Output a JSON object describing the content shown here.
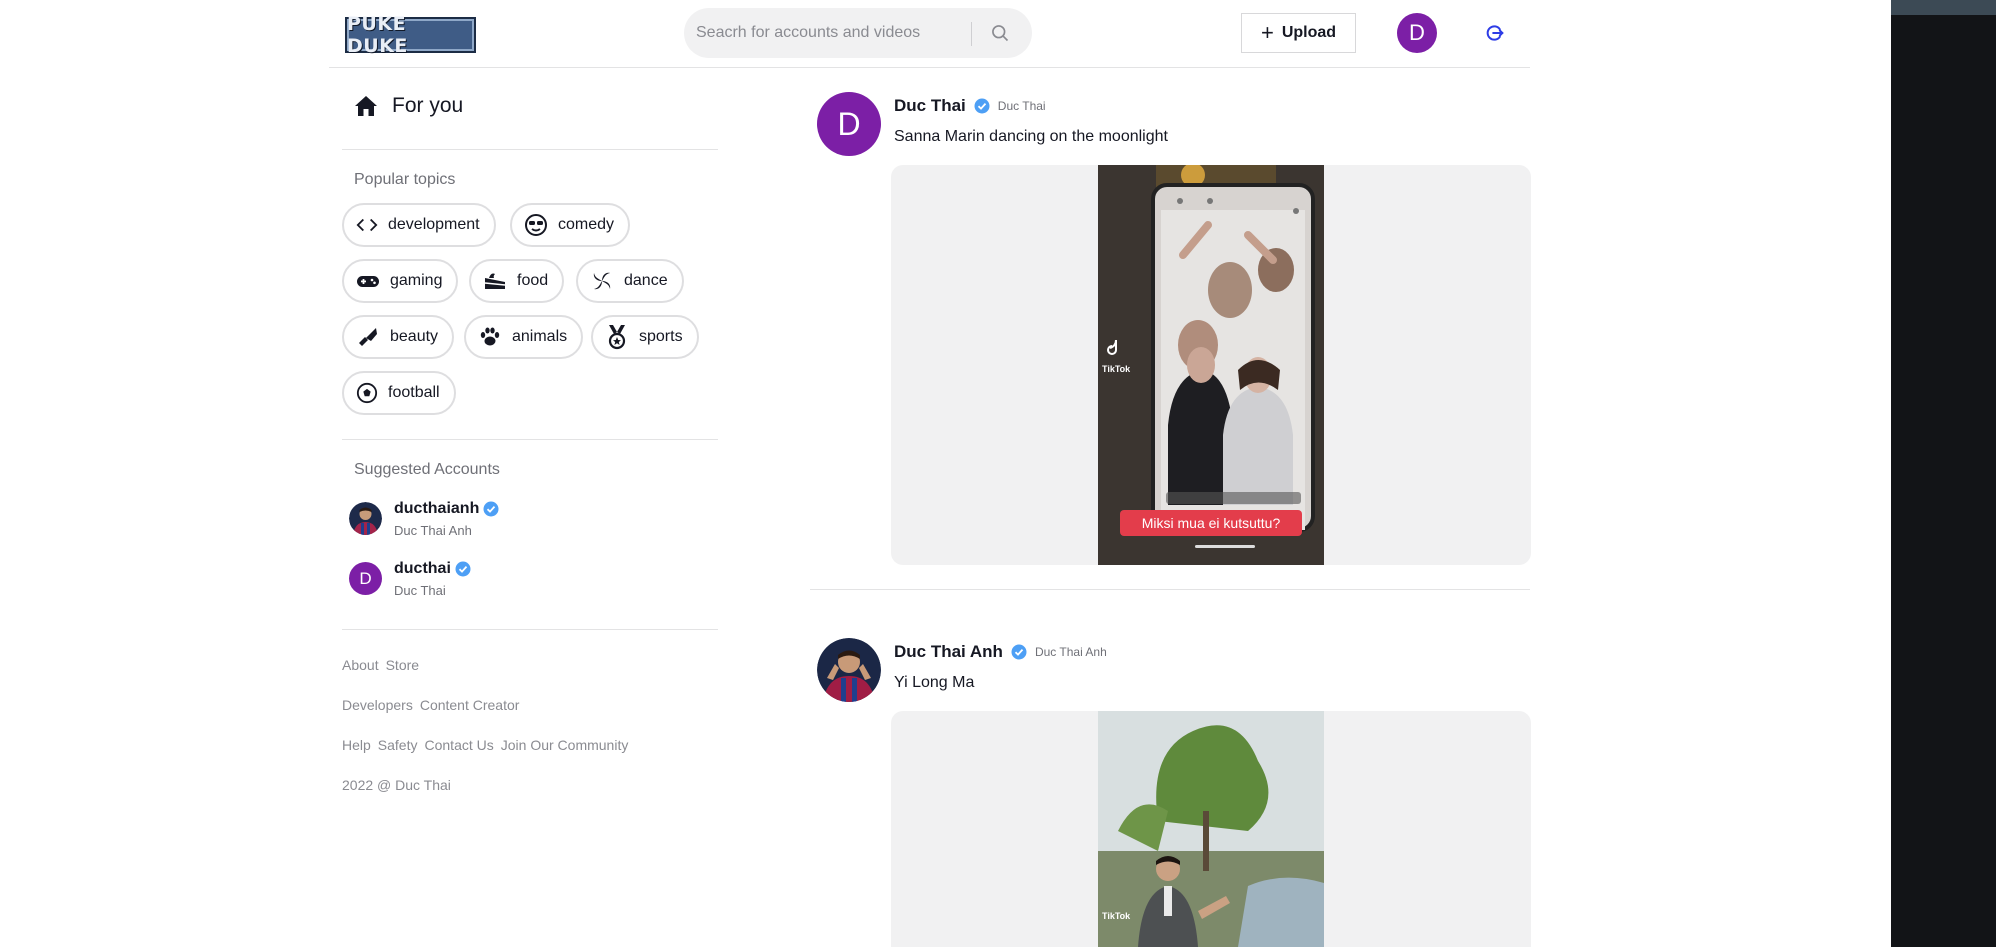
{
  "header": {
    "logo_text": "PUKE DUKE",
    "search_placeholder": "Seacrh for accounts and videos",
    "upload_label": "Upload",
    "avatar_letter": "D"
  },
  "sidebar": {
    "for_you": "For you",
    "popular_topics_title": "Popular topics",
    "topics": [
      {
        "label": "development",
        "icon": "code-icon"
      },
      {
        "label": "comedy",
        "icon": "sunglasses-face-icon"
      },
      {
        "label": "gaming",
        "icon": "gamepad-icon"
      },
      {
        "label": "food",
        "icon": "cake-icon"
      },
      {
        "label": "dance",
        "icon": "dance-swirl-icon"
      },
      {
        "label": "beauty",
        "icon": "lipstick-icon"
      },
      {
        "label": "animals",
        "icon": "paw-icon"
      },
      {
        "label": "sports",
        "icon": "medal-icon"
      },
      {
        "label": "football",
        "icon": "soccer-ball-icon"
      }
    ],
    "suggested_title": "Suggested Accounts",
    "accounts": [
      {
        "username": "ducthaianh",
        "name": "Duc Thai Anh",
        "verified": true
      },
      {
        "username": "ducthai",
        "name": "Duc Thai",
        "verified": true,
        "avatar_letter": "D"
      }
    ],
    "footer_rows": [
      [
        "About",
        "Store"
      ],
      [
        "Developers",
        "Content Creator"
      ],
      [
        "Help",
        "Safety",
        "Contact Us",
        "Join Our Community"
      ],
      [
        "2022 @ Duc Thai"
      ]
    ]
  },
  "feed": [
    {
      "name": "Duc Thai",
      "nickname": "Duc Thai",
      "avatar_letter": "D",
      "caption": "Sanna Marin dancing on the moonlight",
      "video_overlay_caption": "Miksi mua ei kutsuttu?",
      "watermark": "TikTok"
    },
    {
      "name": "Duc Thai Anh",
      "nickname": "Duc Thai Anh",
      "caption": "Yi Long Ma",
      "watermark": "TikTok"
    }
  ],
  "colors": {
    "accent_purple": "#7c1fa6",
    "verified_blue": "#20d5ec",
    "logout_blue": "#2d3ce6"
  }
}
